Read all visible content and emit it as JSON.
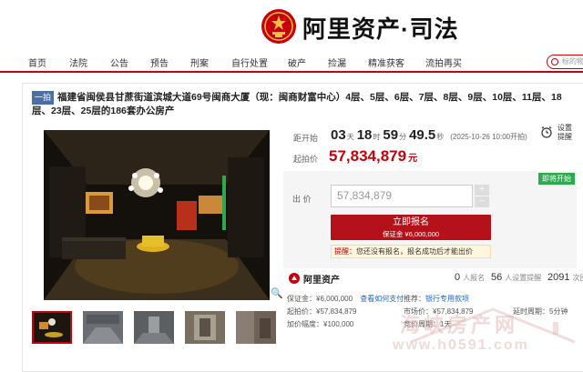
{
  "header": {
    "logo_text": "阿里资产·司法",
    "emblem_icon": "court-emblem-icon"
  },
  "nav": {
    "items": [
      "首页",
      "法院",
      "公告",
      "预告",
      "刑案",
      "自行处置",
      "破产",
      "捡漏",
      "精准获客",
      "流拍再买"
    ],
    "search_placeholder": "标的物"
  },
  "auction": {
    "badge": "一拍",
    "title": "福建省闽侯县甘蔗街道滨城大道69号闽商大厦（现：闽商财富中心）4层、5层、6层、7层、8层、9层、10层、11层、18层、23层、25层的186套办公房产",
    "countdown_label": "距开始",
    "countdown": {
      "days": "03",
      "days_unit": "天",
      "hours": "18",
      "hours_unit": "时",
      "minutes": "59",
      "minutes_unit": "分",
      "seconds": "49.5",
      "seconds_unit": "秒",
      "deadline": "(2025-10-26 10:00开拍)"
    },
    "reminder_label": "设置提醒",
    "start_price_label": "起拍价",
    "start_price": "57,834,879",
    "start_price_unit": "元",
    "status_tag": "即将开始",
    "bid_label": "出  价",
    "bid_value": "57,834,879",
    "step_up": "+",
    "step_down": "−",
    "signup_label": "立即报名",
    "signup_deposit": "保证金 ¥6,000,000",
    "tip_prefix": "提醒：",
    "tip_text": "您还没有报名，报名成功后才能出价"
  },
  "stats": {
    "brand": "阿里资产",
    "signups": "0",
    "signups_label": "人报名",
    "reminders": "56",
    "reminders_label": "人设置提醒",
    "views": "2091",
    "views_label": "次围观"
  },
  "info": {
    "deposit_label": "保证金：",
    "deposit_value": "¥6,000,000",
    "deposit_link": "查看如何支付",
    "recommend_label": "推荐：",
    "recommend_link": "银行专用款项",
    "start_label": "起拍价：",
    "start_value": "¥57,834,879",
    "market_label": "市场价：",
    "market_value": "¥57,834,879",
    "delay_label": "延时周期：",
    "delay_value": "5分钟",
    "increment_label": "加价幅度：",
    "increment_value": "¥100,000",
    "cycle_label": "竞价周期：",
    "cycle_value": "1天"
  },
  "watermark": {
    "text": "海峡房产网",
    "url": "www.h0591.com"
  },
  "colors": {
    "brand_red": "#c7000b",
    "button_red": "#b5111b",
    "status_green": "#2eaa4e",
    "badge_blue": "#4a6fa5",
    "link_blue": "#1e66c8"
  }
}
